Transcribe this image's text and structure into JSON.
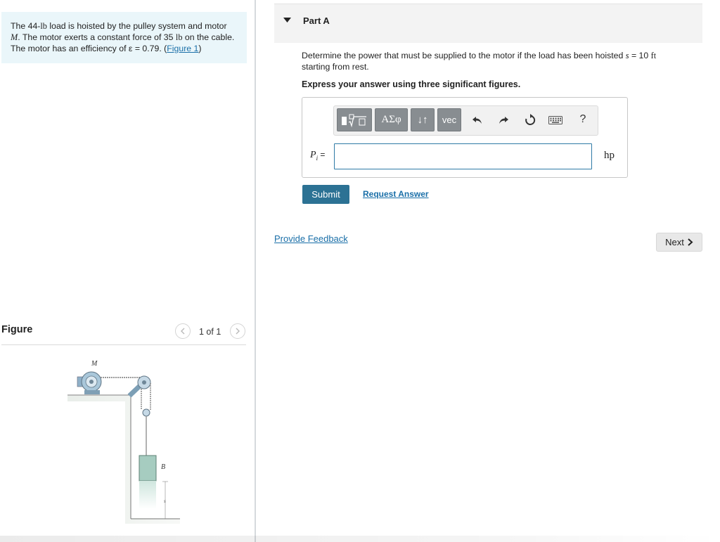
{
  "problem": {
    "text_1": "The 44-",
    "unit_lb_1": "lb",
    "text_2": " load is hoisted by the pulley system and motor ",
    "var_M": "M",
    "text_3": ". The motor exerts a constant force of 35 ",
    "unit_lb_2": "lb",
    "text_4": " on the cable. The motor has an efficiency of ε = 0.79. (",
    "figure_link": "Figure 1",
    "text_5": ")"
  },
  "figure": {
    "heading": "Figure",
    "pager": "1 of 1",
    "label_motor": "M",
    "label_load": "B",
    "label_s": "s"
  },
  "part": {
    "title": "Part A",
    "question_1": "Determine the power that must be supplied to the motor if the load has been hoisted ",
    "question_var": "s",
    "question_2": " = 10 ",
    "question_unit": "ft",
    "question_3": " starting from rest.",
    "instruction": "Express your answer using three significant figures."
  },
  "toolbar": {
    "templates_icon": "fraction-sqrt-template-icon",
    "greek_label": "ΑΣφ",
    "arrows_label": "↓↑",
    "vec_label": "vec",
    "help_label": "?"
  },
  "answer": {
    "var_label": "P",
    "var_sub": "i",
    "equals": " =",
    "value": "",
    "unit": "hp"
  },
  "actions": {
    "submit": "Submit",
    "request_answer": "Request Answer",
    "provide_feedback": "Provide Feedback",
    "next": "Next"
  },
  "colors": {
    "problem_bg": "#eaf6fa",
    "link": "#1a6fa8",
    "submit_bg": "#2c7294",
    "toolbar_btn": "#888d91"
  }
}
